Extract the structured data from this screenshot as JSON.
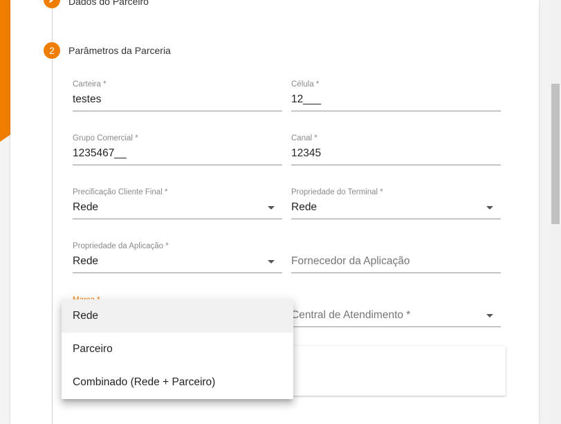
{
  "steps": [
    {
      "number": "",
      "label": "Dados do Parceiro",
      "icon": "pencil-icon"
    },
    {
      "number": "2",
      "label": "Parâmetros da Parceria"
    }
  ],
  "fields": {
    "carteira": {
      "label": "Carteira *",
      "value": "testes"
    },
    "celula": {
      "label": "Célula *",
      "value": "12___"
    },
    "grupo_comercial": {
      "label": "Grupo Comercial *",
      "value": "1235467__"
    },
    "canal": {
      "label": "Canal *",
      "value": "12345"
    },
    "precificacao": {
      "label": "Precificação Cliente Final *",
      "value": "Rede"
    },
    "propriedade_terminal": {
      "label": "Propriedade do Terminal *",
      "value": "Rede"
    },
    "propriedade_aplicacao": {
      "label": "Propriedade da Aplicação *",
      "value": "Rede"
    },
    "fornecedor_aplicacao": {
      "placeholder": "Fornecedor da Aplicação"
    },
    "marca": {
      "label": "Marca *"
    },
    "central_atendimento": {
      "placeholder": "Central de Atendimento *"
    }
  },
  "dropdown": {
    "options": [
      "Rede",
      "Parceiro",
      "Combinado (Rede + Parceiro)"
    ],
    "highlighted_index": 0
  },
  "colors": {
    "accent": "#ef7d00"
  }
}
